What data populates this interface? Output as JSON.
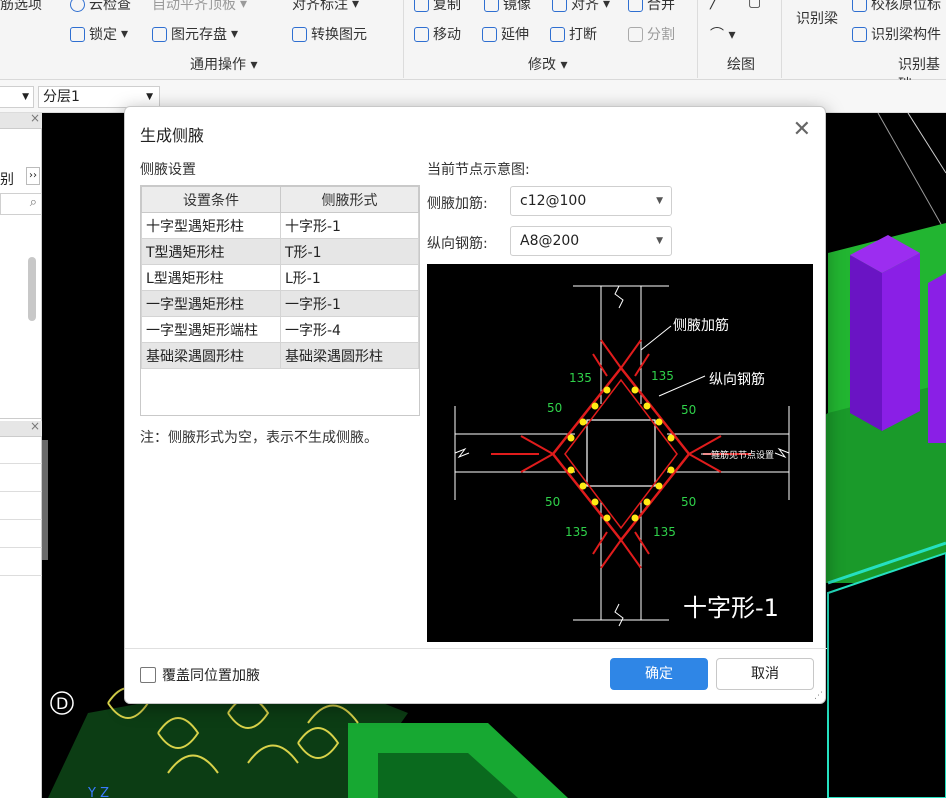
{
  "ribbon": {
    "row1": [
      "筋选项",
      "云检查",
      "自动平齐顶板",
      "对齐标注",
      "复制",
      "镜像",
      "对齐",
      "合并",
      "识别梁",
      "校核原位标"
    ],
    "row2": [
      "锁定",
      "图元存盘",
      "转换图元",
      "移动",
      "延伸",
      "打断",
      "分割",
      "识别梁构件"
    ],
    "groups": [
      "通用操作",
      "修改",
      "绘图",
      "识别基础"
    ]
  },
  "toolbar2": {
    "combo1": "",
    "combo2": "分层1"
  },
  "leftpanel": {
    "text1": "别",
    "arrow": "››"
  },
  "dialog": {
    "title": "生成侧腋",
    "section": "侧腋设置",
    "table": {
      "headers": [
        "设置条件",
        "侧腋形式"
      ],
      "rows": [
        [
          "十字型遇矩形柱",
          "十字形-1"
        ],
        [
          "T型遇矩形柱",
          "T形-1"
        ],
        [
          "L型遇矩形柱",
          "L形-1"
        ],
        [
          "一字型遇矩形柱",
          "一字形-1"
        ],
        [
          "一字型遇矩形端柱",
          "一字形-4"
        ],
        [
          "基础梁遇圆形柱",
          "基础梁遇圆形柱"
        ]
      ]
    },
    "note": "注：侧腋形式为空，表示不生成侧腋。",
    "preview_title": "当前节点示意图:",
    "rebar_label": "侧腋加筋:",
    "rebar_value": "c12@100",
    "long_label": "纵向钢筋:",
    "long_value": "A8@200",
    "diagram": {
      "label_rebar": "侧腋加筋",
      "label_long": "纵向钢筋",
      "label_ref": "箍筋见节点设置",
      "caption": "十字形-1",
      "dims": [
        "135",
        "135",
        "135",
        "135",
        "50",
        "50",
        "50",
        "50"
      ]
    },
    "checkbox_label": "覆盖同位置加腋",
    "ok": "确定",
    "cancel": "取消"
  },
  "viewport": {
    "axis_label": "D",
    "yz": "Y Z"
  }
}
